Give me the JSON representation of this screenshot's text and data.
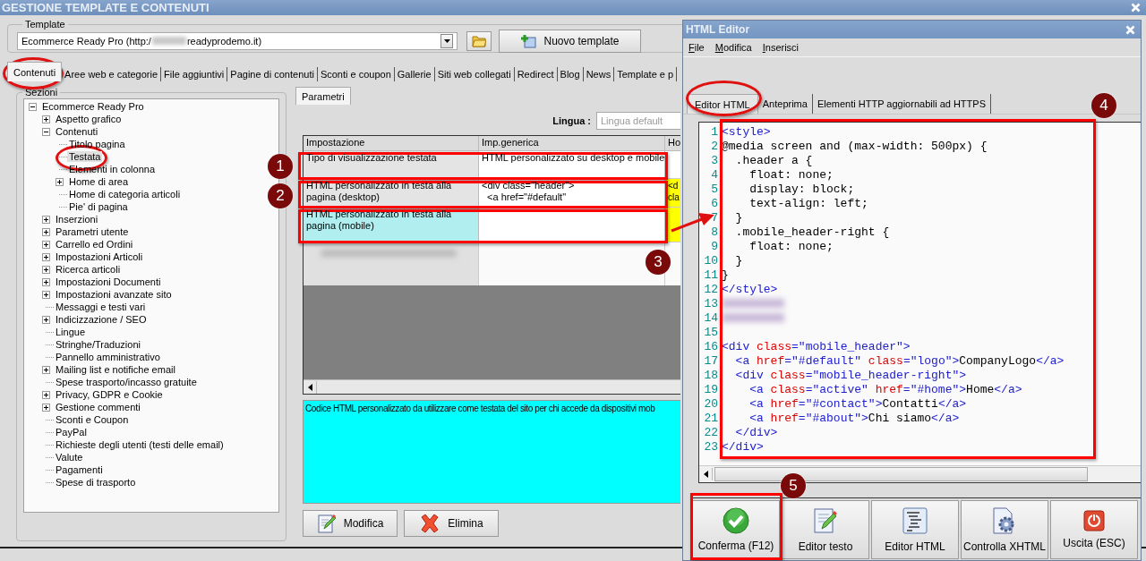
{
  "window": {
    "title": "GESTIONE TEMPLATE E CONTENUTI"
  },
  "template": {
    "label": "Template",
    "value": "Ecommerce Ready Pro (http:/",
    "value_end": "readyprodemo.it)",
    "new_button": "Nuovo template"
  },
  "tabs": [
    {
      "label": "Contenuti",
      "selected": true
    },
    {
      "label": "Aree web e categorie",
      "selected": false
    },
    {
      "label": "File aggiuntivi",
      "selected": false
    },
    {
      "label": "Pagine di contenuti",
      "selected": false
    },
    {
      "label": "Sconti e coupon",
      "selected": false
    },
    {
      "label": "Gallerie",
      "selected": false
    },
    {
      "label": "Siti web collegati",
      "selected": false
    },
    {
      "label": "Redirect",
      "selected": false
    },
    {
      "label": "Blog",
      "selected": false
    },
    {
      "label": "News",
      "selected": false
    },
    {
      "label": "Template e p",
      "selected": false
    }
  ],
  "sections": {
    "label": "Sezioni",
    "tree": [
      {
        "label": "Ecommerce Ready Pro",
        "kind": "group",
        "expanded": true,
        "selected": false,
        "children": [
          {
            "label": "Aspetto grafico",
            "kind": "group",
            "expanded": false,
            "selected": false
          },
          {
            "label": "Contenuti",
            "kind": "group",
            "expanded": true,
            "selected": false,
            "children": [
              {
                "label": "Titolo pagina",
                "kind": "leaf",
                "selected": false
              },
              {
                "label": "Testata",
                "kind": "leaf",
                "selected": true
              },
              {
                "label": "Elementi in colonna",
                "kind": "leaf",
                "selected": false
              },
              {
                "label": "Home di area",
                "kind": "group",
                "expanded": false,
                "selected": false
              },
              {
                "label": "Home di categoria articoli",
                "kind": "leaf",
                "selected": false
              },
              {
                "label": "Pie' di pagina",
                "kind": "leaf",
                "selected": false
              }
            ]
          },
          {
            "label": "Inserzioni",
            "kind": "group",
            "expanded": false,
            "selected": false
          },
          {
            "label": "Parametri utente",
            "kind": "group",
            "expanded": false,
            "selected": false
          },
          {
            "label": "Carrello ed Ordini",
            "kind": "group",
            "expanded": false,
            "selected": false
          },
          {
            "label": "Impostazioni Articoli",
            "kind": "group",
            "expanded": false,
            "selected": false
          },
          {
            "label": "Ricerca articoli",
            "kind": "group",
            "expanded": false,
            "selected": false
          },
          {
            "label": "Impostazioni Documenti",
            "kind": "group",
            "expanded": false,
            "selected": false
          },
          {
            "label": "Impostazioni avanzate sito",
            "kind": "group",
            "expanded": false,
            "selected": false
          },
          {
            "label": "Messaggi e testi vari",
            "kind": "leaf",
            "selected": false
          },
          {
            "label": "Indicizzazione / SEO",
            "kind": "group",
            "expanded": false,
            "selected": false
          },
          {
            "label": "Lingue",
            "kind": "leaf",
            "selected": false
          },
          {
            "label": "Stringhe/Traduzioni",
            "kind": "leaf",
            "selected": false
          },
          {
            "label": "Pannello amministrativo",
            "kind": "leaf",
            "selected": false
          },
          {
            "label": "Mailing list e notifiche email",
            "kind": "group",
            "expanded": false,
            "selected": false
          },
          {
            "label": "Spese trasporto/incasso gratuite",
            "kind": "leaf",
            "selected": false
          },
          {
            "label": "Privacy, GDPR e Cookie",
            "kind": "group",
            "expanded": false,
            "selected": false
          },
          {
            "label": "Gestione commenti",
            "kind": "group",
            "expanded": false,
            "selected": false
          },
          {
            "label": "Sconti e Coupon",
            "kind": "leaf",
            "selected": false
          },
          {
            "label": "PayPal",
            "kind": "leaf",
            "selected": false
          },
          {
            "label": "Richieste degli utenti (testi delle email)",
            "kind": "leaf",
            "selected": false
          },
          {
            "label": "Valute",
            "kind": "leaf",
            "selected": false
          },
          {
            "label": "Pagamenti",
            "kind": "leaf",
            "selected": false
          },
          {
            "label": "Spese di trasporto",
            "kind": "leaf",
            "selected": false
          }
        ]
      }
    ]
  },
  "params": {
    "tabs": [
      {
        "label": "Parametri",
        "selected": true
      }
    ],
    "language_label": "Lingua :",
    "language_value": "Lingua default",
    "grid": {
      "columns": [
        "Impostazione",
        "Imp.generica",
        "Ho"
      ],
      "rows": [
        {
          "kind": "normal",
          "setting": "Tipo di visualizzazione testata",
          "generic": "HTML personalizzato su desktop e mobile",
          "column_3_highlight": false,
          "selected": false
        },
        {
          "kind": "normal",
          "setting": "HTML personalizzato in testa alla pagina (desktop)",
          "generic": "<div class=\"header\">\n  <a href=\"#default\"",
          "column_3": "<d\ncla",
          "column_3_highlight": true,
          "selected": false
        },
        {
          "kind": "normal",
          "setting": "HTML personalizzato in testa alla pagina (mobile)",
          "column_3_highlight": true,
          "selected": true
        },
        {
          "kind": "blurred"
        }
      ]
    },
    "description": "Codice HTML personalizzato da utilizzare come testata del sito per chi accede da dispositivi mob",
    "buttons": [
      {
        "label": "Modifica",
        "kind": "edit"
      },
      {
        "label": "Elimina",
        "kind": "delete"
      }
    ]
  },
  "editor": {
    "title": "HTML Editor",
    "menu": [
      "File",
      "Modifica",
      "Inserisci"
    ],
    "tabs": [
      {
        "label": "Editor HTML",
        "selected": true
      },
      {
        "label": "Anteprima",
        "selected": false
      },
      {
        "label": "Elementi HTTP aggiornabili ad HTTPS",
        "selected": false
      }
    ],
    "code_lines": [
      {
        "number": "1",
        "kind": "code",
        "segments": [
          {
            "kind": "tag",
            "text": "<style>"
          }
        ]
      },
      {
        "number": "2",
        "kind": "code",
        "segments": [
          {
            "kind": "text",
            "text": "@media screen and (max-width: 500px) {"
          }
        ]
      },
      {
        "number": "3",
        "kind": "code",
        "segments": [
          {
            "kind": "text",
            "text": "  .header a {"
          }
        ]
      },
      {
        "number": "4",
        "kind": "code",
        "segments": [
          {
            "kind": "text",
            "text": "    float: none;"
          }
        ]
      },
      {
        "number": "5",
        "kind": "code",
        "segments": [
          {
            "kind": "text",
            "text": "    display: block;"
          }
        ]
      },
      {
        "number": "6",
        "kind": "code",
        "segments": [
          {
            "kind": "text",
            "text": "    text-align: left;"
          }
        ]
      },
      {
        "number": "7",
        "kind": "code",
        "segments": [
          {
            "kind": "text",
            "text": "  }"
          }
        ]
      },
      {
        "number": "8",
        "kind": "code",
        "segments": [
          {
            "kind": "text",
            "text": "  .mobile_header-right {"
          }
        ]
      },
      {
        "number": "9",
        "kind": "code",
        "segments": [
          {
            "kind": "text",
            "text": "    float: none;"
          }
        ]
      },
      {
        "number": "10",
        "kind": "code",
        "segments": [
          {
            "kind": "text",
            "text": "  }"
          }
        ]
      },
      {
        "number": "11",
        "kind": "code",
        "segments": [
          {
            "kind": "text",
            "text": "}"
          }
        ]
      },
      {
        "number": "12",
        "kind": "code",
        "segments": [
          {
            "kind": "tag",
            "text": "</style>"
          }
        ]
      },
      {
        "number": "13",
        "kind": "blurred"
      },
      {
        "number": "14",
        "kind": "blurred"
      },
      {
        "number": "15",
        "kind": "code"
      },
      {
        "number": "16",
        "kind": "code",
        "segments": [
          {
            "kind": "tag",
            "text": "<div"
          },
          {
            "kind": "attr",
            "text": " class"
          },
          {
            "kind": "tag",
            "text": "=\"mobile_header\">"
          }
        ]
      },
      {
        "number": "17",
        "kind": "code",
        "segments": [
          {
            "kind": "tag",
            "text": "  <a"
          },
          {
            "kind": "attr",
            "text": " href"
          },
          {
            "kind": "tag",
            "text": "=\"#default\""
          },
          {
            "kind": "attr",
            "text": " class"
          },
          {
            "kind": "tag",
            "text": "=\"logo\">"
          },
          {
            "kind": "text",
            "text": "CompanyLogo"
          },
          {
            "kind": "tag",
            "text": "</a>"
          }
        ]
      },
      {
        "number": "18",
        "kind": "code",
        "segments": [
          {
            "kind": "tag",
            "text": "  <div"
          },
          {
            "kind": "attr",
            "text": " class"
          },
          {
            "kind": "tag",
            "text": "=\"mobile_header-right\">"
          }
        ]
      },
      {
        "number": "19",
        "kind": "code",
        "segments": [
          {
            "kind": "tag",
            "text": "    <a"
          },
          {
            "kind": "attr",
            "text": " class"
          },
          {
            "kind": "tag",
            "text": "=\"active\""
          },
          {
            "kind": "attr",
            "text": " href"
          },
          {
            "kind": "tag",
            "text": "=\"#home\">"
          },
          {
            "kind": "text",
            "text": "Home"
          },
          {
            "kind": "tag",
            "text": "</a>"
          }
        ]
      },
      {
        "number": "20",
        "kind": "code",
        "segments": [
          {
            "kind": "tag",
            "text": "    <a"
          },
          {
            "kind": "attr",
            "text": " href"
          },
          {
            "kind": "tag",
            "text": "=\"#contact\">"
          },
          {
            "kind": "text",
            "text": "Contatti"
          },
          {
            "kind": "tag",
            "text": "</a>"
          }
        ]
      },
      {
        "number": "21",
        "kind": "code",
        "segments": [
          {
            "kind": "tag",
            "text": "    <a"
          },
          {
            "kind": "attr",
            "text": " href"
          },
          {
            "kind": "tag",
            "text": "=\"#about\">"
          },
          {
            "kind": "text",
            "text": "Chi siamo"
          },
          {
            "kind": "tag",
            "text": "</a>"
          }
        ]
      },
      {
        "number": "22",
        "kind": "code",
        "segments": [
          {
            "kind": "tag",
            "text": "  </div>"
          }
        ]
      },
      {
        "number": "23",
        "kind": "code",
        "segments": [
          {
            "kind": "tag",
            "text": "</div>"
          }
        ]
      }
    ],
    "buttons": [
      {
        "label": "Conferma (F12)",
        "kind": "confirm"
      },
      {
        "label": "Editor testo",
        "kind": "text_editor"
      },
      {
        "label": "Editor HTML",
        "kind": "html_editor"
      },
      {
        "label": "Controlla XHTML",
        "kind": "validate"
      },
      {
        "label": "Uscita (ESC)",
        "kind": "exit"
      }
    ]
  },
  "annotations": [
    {
      "kind": "ellipse"
    },
    {
      "kind": "ellipse"
    },
    {
      "kind": "ellipse"
    },
    {
      "kind": "frame"
    },
    {
      "kind": "frame"
    },
    {
      "kind": "frame"
    },
    {
      "kind": "frame"
    },
    {
      "kind": "frame"
    },
    {
      "kind": "badge",
      "label": "1"
    },
    {
      "kind": "badge",
      "label": "2"
    },
    {
      "kind": "badge",
      "label": "3"
    },
    {
      "kind": "badge",
      "label": "4"
    },
    {
      "kind": "badge",
      "label": "5"
    },
    {
      "kind": "arrow"
    }
  ]
}
